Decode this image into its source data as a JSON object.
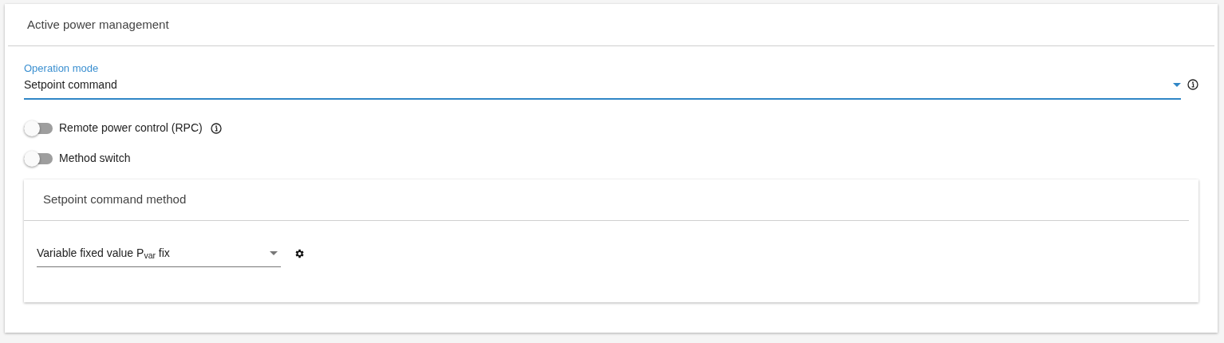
{
  "card": {
    "title": "Active power management"
  },
  "operation_mode": {
    "label": "Operation mode",
    "value": "Setpoint command",
    "focused": true
  },
  "toggles": [
    {
      "label": "Remote power control (RPC)",
      "on": false,
      "info": true
    },
    {
      "label": "Method switch",
      "on": false,
      "info": false
    }
  ],
  "method_card": {
    "title": "Setpoint command method",
    "select": {
      "value": "Variable fixed value P$_{var}$ fix"
    }
  }
}
